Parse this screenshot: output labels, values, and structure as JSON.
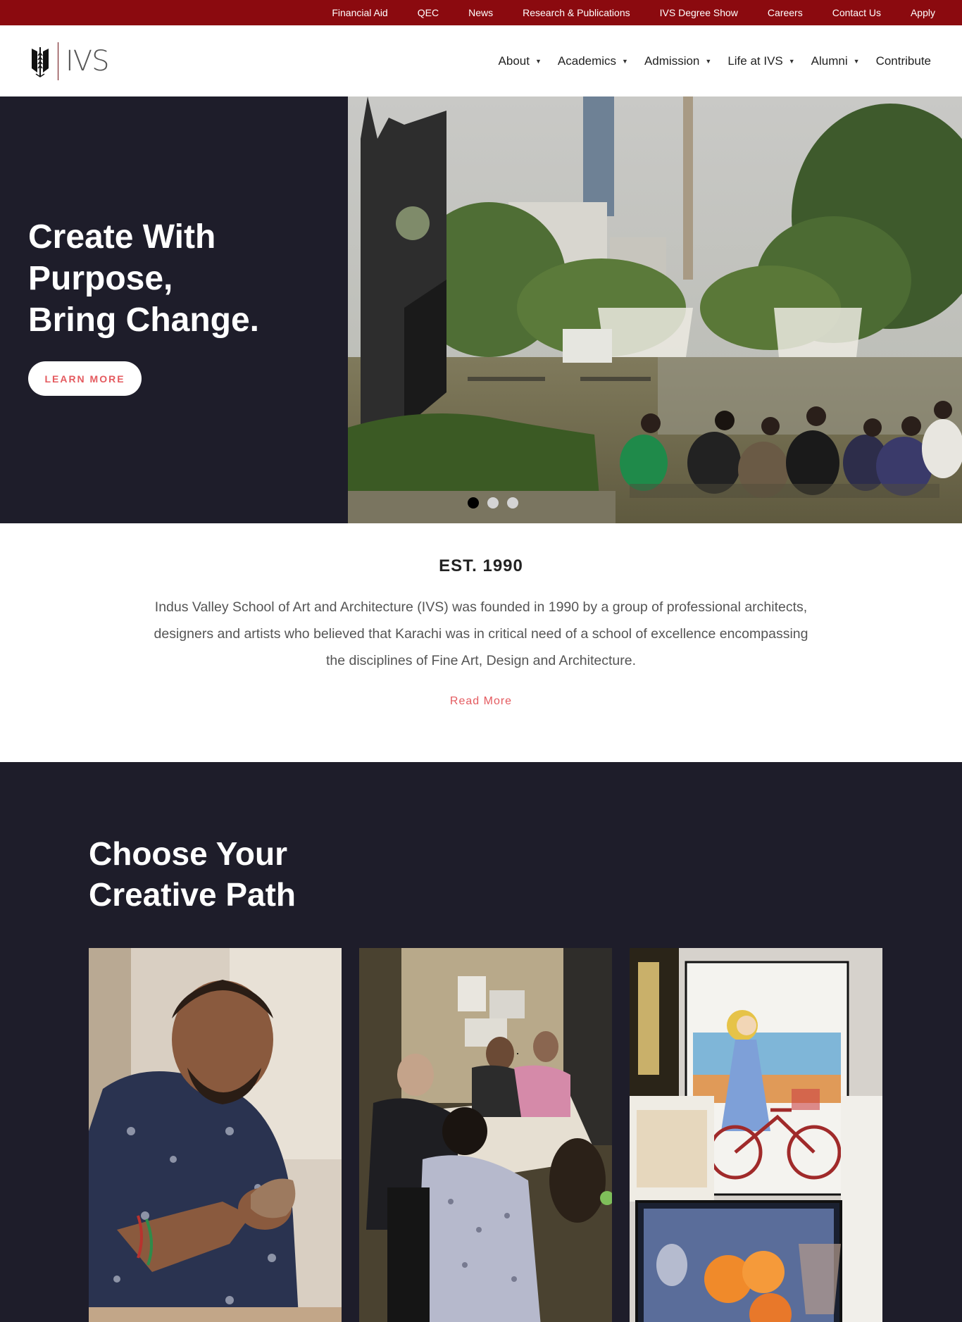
{
  "topbar": {
    "links": [
      "Financial Aid",
      "QEC",
      "News",
      "Research & Publications",
      "IVS Degree Show",
      "Careers",
      "Contact Us",
      "Apply"
    ]
  },
  "header": {
    "logo_text": "IVS",
    "nav": [
      {
        "label": "About",
        "dropdown": true
      },
      {
        "label": "Academics",
        "dropdown": true
      },
      {
        "label": "Admission",
        "dropdown": true
      },
      {
        "label": "Life at IVS",
        "dropdown": true
      },
      {
        "label": "Alumni",
        "dropdown": true
      },
      {
        "label": "Contribute",
        "dropdown": false
      }
    ]
  },
  "hero": {
    "title_lines": [
      "Create With",
      "Purpose,",
      "Bring Change."
    ],
    "cta_label": "LEARN MORE",
    "slide_count": 3,
    "active_slide": 1
  },
  "about": {
    "heading": "EST. 1990",
    "paragraph": "Indus Valley School of Art and Architecture (IVS) was founded in 1990 by a group of professional architects, designers and artists who believed that Karachi was in critical need of a school of excellence encompassing the disciplines of Fine Art, Design and Architecture.",
    "read_more": "Read More"
  },
  "paths": {
    "title_lines": [
      "Choose Your",
      "Creative Path"
    ]
  },
  "colors": {
    "topbar_bg": "#8b0a0f",
    "dark_bg": "#1e1d2a",
    "accent": "#e45a5f",
    "white": "#ffffff"
  }
}
